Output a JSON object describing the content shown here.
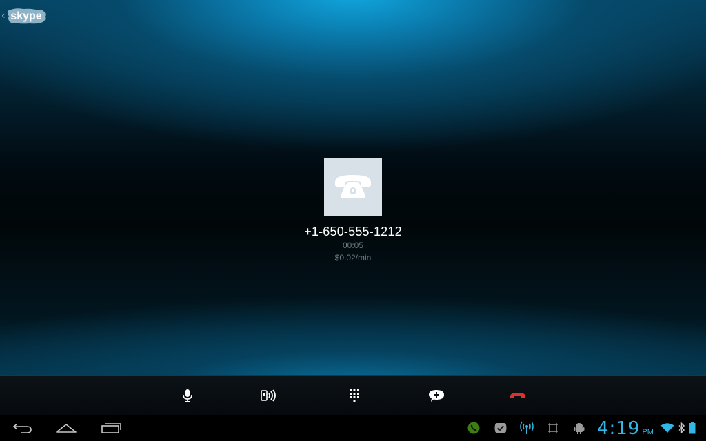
{
  "app": {
    "logo_text": "skype",
    "back_chevron": "‹"
  },
  "call": {
    "avatar_icon": "telephone-icon",
    "number": "+1-650-555-1212",
    "duration": "00:05",
    "rate": "$0.02/min"
  },
  "controls": {
    "items": [
      {
        "name": "mute-button",
        "icon": "microphone-icon"
      },
      {
        "name": "speaker-button",
        "icon": "speakerphone-icon"
      },
      {
        "name": "dialpad-button",
        "icon": "dialpad-icon"
      },
      {
        "name": "chat-button",
        "icon": "chat-add-icon"
      },
      {
        "name": "end-call-button",
        "icon": "hang-up-icon",
        "color": "#e0302a"
      }
    ]
  },
  "system_bar": {
    "nav": [
      "back-icon",
      "home-icon",
      "recent-apps-icon"
    ],
    "notifications": [
      "call-notification-icon",
      "skype-notification-icon",
      "signal-broadcast-icon",
      "screenshot-icon",
      "android-debug-icon"
    ],
    "time": "4:19",
    "ampm": "PM",
    "status": [
      "wifi-icon",
      "bluetooth-icon",
      "battery-icon"
    ],
    "accent_color": "#33b5e5"
  }
}
